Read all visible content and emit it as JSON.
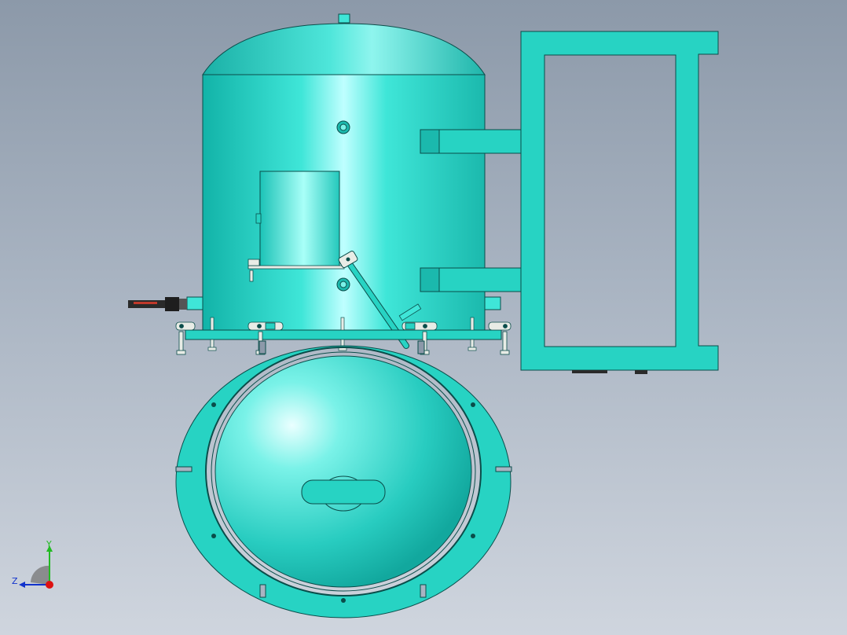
{
  "viewport": {
    "background_top": "#8c99a9",
    "background_bottom": "#cfd5de"
  },
  "model": {
    "body_color": "#27d3c3",
    "highlight_color": "#bfffff",
    "shadow_color": "#0f9f96",
    "edge_color": "#0a4d4a",
    "bolt_color": "#e8ece6",
    "connector_color": "#2a2a2a",
    "connector_accent": "#c0392b"
  },
  "triad": {
    "y_label": "Y",
    "z_label": "Z",
    "y_color": "#22bb22",
    "z_color": "#1133cc",
    "x_color": "#dd1111"
  }
}
